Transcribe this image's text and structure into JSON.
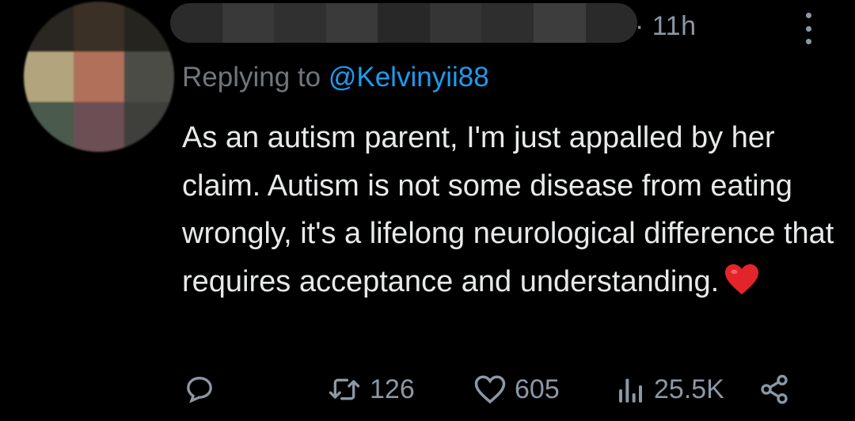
{
  "tweet": {
    "time": "· 11h",
    "reply_prefix": "Replying to",
    "reply_handle": "@Kelvinyii88",
    "text": "As an autism parent, I'm just appalled by her claim. Autism is not some disease from eating wrongly, it's a lifelong neurological difference that requires acceptance and understanding.",
    "emoji": "red-heart-emoji"
  },
  "actions": {
    "reply_icon": "reply-icon",
    "retweet_icon": "retweet-icon",
    "retweet_count": "126",
    "like_icon": "like-icon",
    "like_count": "605",
    "views_icon": "views-icon",
    "views_count": "25.5K",
    "share_icon": "share-icon"
  },
  "colors": {
    "background": "#000000",
    "text": "#e7e9ea",
    "secondary": "#8b98a5",
    "link": "#1d9bf0",
    "heart": "#e3242b"
  }
}
